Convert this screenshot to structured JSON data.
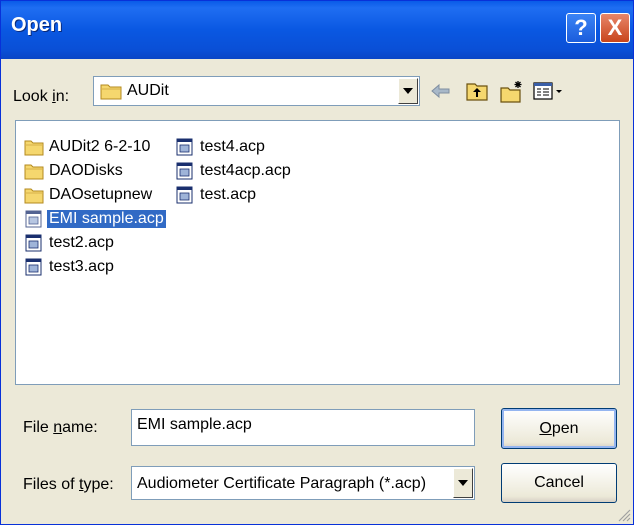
{
  "window": {
    "title": "Open",
    "help_symbol": "?",
    "close_symbol": "X"
  },
  "lookin": {
    "label_pre": "Look ",
    "label_accel": "i",
    "label_post": "n:",
    "value": "AUDit"
  },
  "toolbar": {
    "icons": [
      "back-arrow-icon",
      "up-one-level-icon",
      "new-folder-icon",
      "view-menu-icon"
    ]
  },
  "files": [
    {
      "name": "AUDit2 6-2-10",
      "type": "folder"
    },
    {
      "name": "DAODisks",
      "type": "folder"
    },
    {
      "name": "DAOsetupnew",
      "type": "folder"
    },
    {
      "name": "EMI sample.acp",
      "type": "file",
      "selected": true
    },
    {
      "name": "test2.acp",
      "type": "file"
    },
    {
      "name": "test3.acp",
      "type": "file"
    },
    {
      "name": "test4.acp",
      "type": "file"
    },
    {
      "name": "test4acp.acp",
      "type": "file"
    },
    {
      "name": "test.acp",
      "type": "file"
    }
  ],
  "filename": {
    "label_pre": "File ",
    "label_accel": "n",
    "label_post": "ame:",
    "value": "EMI sample.acp"
  },
  "filetype": {
    "label_pre": "Files of ",
    "label_accel": "t",
    "label_post": "ype:",
    "value": "Audiometer Certificate Paragraph (*.acp)"
  },
  "buttons": {
    "open_accel": "O",
    "open_rest": "pen",
    "cancel": "Cancel"
  },
  "colors": {
    "titlebar": "#0a58e2",
    "selection": "#316ac5",
    "dialog_bg": "#ece9d8"
  }
}
